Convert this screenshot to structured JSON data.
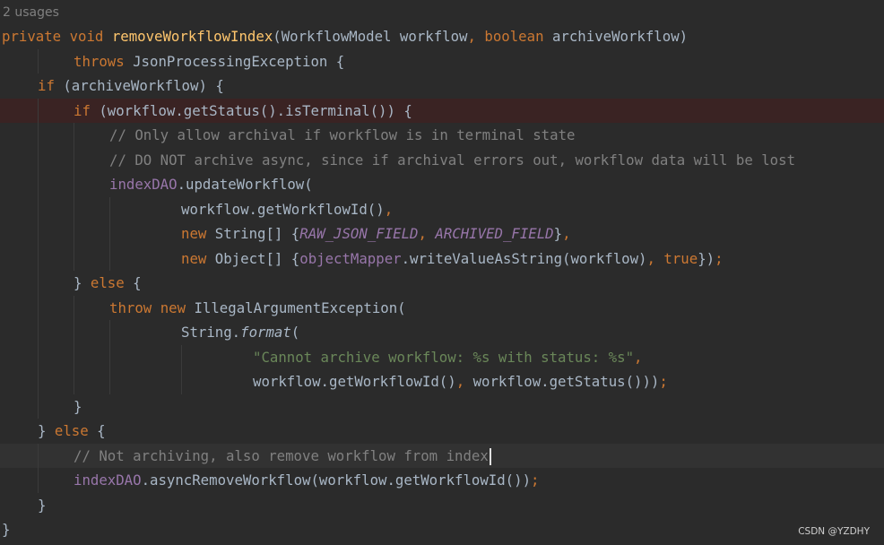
{
  "editor": {
    "usages_hint": "2 usages",
    "colors": {
      "background": "#2b2b2b",
      "default_text": "#a9b7c6",
      "keyword": "#cc7832",
      "method_declaration": "#ffc66d",
      "field": "#9876aa",
      "string": "#6a8759",
      "comment": "#808080",
      "breakpoint_line": "#3a2323",
      "current_line": "#323232"
    },
    "lines": [
      {
        "tokens": [
          {
            "t": "private",
            "k": "kw"
          },
          {
            "t": " "
          },
          {
            "t": "void",
            "k": "kw"
          },
          {
            "t": " "
          },
          {
            "t": "removeWorkflowIndex",
            "k": "fn"
          },
          {
            "t": "(WorkflowModel workflow"
          },
          {
            "t": ",",
            "k": "kw"
          },
          {
            "t": " "
          },
          {
            "t": "boolean",
            "k": "kw"
          },
          {
            "t": " archiveWorkflow)"
          }
        ]
      },
      {
        "tokens": [
          {
            "t": "throws",
            "k": "kw"
          },
          {
            "t": " JsonProcessingException {"
          }
        ]
      },
      {
        "tokens": [
          {
            "t": "if",
            "k": "kw"
          },
          {
            "t": " (archiveWorkflow) {"
          }
        ]
      },
      {
        "tokens": [
          {
            "t": "if",
            "k": "kw"
          },
          {
            "t": " (workflow.getStatus().isTerminal()) {"
          }
        ]
      },
      {
        "tokens": [
          {
            "t": "// Only allow archival if workflow is in terminal state",
            "k": "cmt"
          }
        ]
      },
      {
        "tokens": [
          {
            "t": "// DO NOT archive async, since if archival errors out, workflow data will be lost",
            "k": "cmt"
          }
        ]
      },
      {
        "tokens": [
          {
            "t": "indexDAO",
            "k": "field"
          },
          {
            "t": ".updateWorkflow("
          }
        ]
      },
      {
        "tokens": [
          {
            "t": "workflow.getWorkflowId()"
          },
          {
            "t": ",",
            "k": "kw"
          }
        ]
      },
      {
        "tokens": [
          {
            "t": "new",
            "k": "kw"
          },
          {
            "t": " String[] {"
          },
          {
            "t": "RAW_JSON_FIELD",
            "k": "const"
          },
          {
            "t": ",",
            "k": "kw"
          },
          {
            "t": " "
          },
          {
            "t": "ARCHIVED_FIELD",
            "k": "const"
          },
          {
            "t": "}"
          },
          {
            "t": ",",
            "k": "kw"
          }
        ]
      },
      {
        "tokens": [
          {
            "t": "new",
            "k": "kw"
          },
          {
            "t": " Object[] {"
          },
          {
            "t": "objectMapper",
            "k": "field"
          },
          {
            "t": ".writeValueAsString(workflow)"
          },
          {
            "t": ",",
            "k": "kw"
          },
          {
            "t": " "
          },
          {
            "t": "true",
            "k": "kw"
          },
          {
            "t": "})"
          },
          {
            "t": ";",
            "k": "kw"
          }
        ]
      },
      {
        "tokens": [
          {
            "t": "} "
          },
          {
            "t": "else",
            "k": "kw"
          },
          {
            "t": " {"
          }
        ]
      },
      {
        "tokens": [
          {
            "t": "throw",
            "k": "kw"
          },
          {
            "t": " "
          },
          {
            "t": "new",
            "k": "kw"
          },
          {
            "t": " IllegalArgumentException("
          }
        ]
      },
      {
        "tokens": [
          {
            "t": "String."
          },
          {
            "t": "format",
            "k": "static"
          },
          {
            "t": "("
          }
        ]
      },
      {
        "tokens": [
          {
            "t": "\"Cannot archive workflow: %s with status: %s\"",
            "k": "str"
          },
          {
            "t": ",",
            "k": "kw"
          }
        ]
      },
      {
        "tokens": [
          {
            "t": "workflow.getWorkflowId()"
          },
          {
            "t": ",",
            "k": "kw"
          },
          {
            "t": " workflow.getStatus()))"
          },
          {
            "t": ";",
            "k": "kw"
          }
        ]
      },
      {
        "tokens": [
          {
            "t": "}"
          }
        ]
      },
      {
        "tokens": [
          {
            "t": "} "
          },
          {
            "t": "else",
            "k": "kw"
          },
          {
            "t": " {"
          }
        ]
      },
      {
        "tokens": [
          {
            "t": "// Not archiving, also remove workflow from index",
            "k": "cmt"
          }
        ]
      },
      {
        "tokens": [
          {
            "t": "indexDAO",
            "k": "field"
          },
          {
            "t": ".asyncRemoveWorkflow(workflow.getWorkflowId())"
          },
          {
            "t": ";",
            "k": "kw"
          }
        ]
      },
      {
        "tokens": [
          {
            "t": "}"
          }
        ]
      },
      {
        "tokens": [
          {
            "t": "}"
          }
        ]
      }
    ]
  },
  "watermark": "CSDN @YZDHY"
}
